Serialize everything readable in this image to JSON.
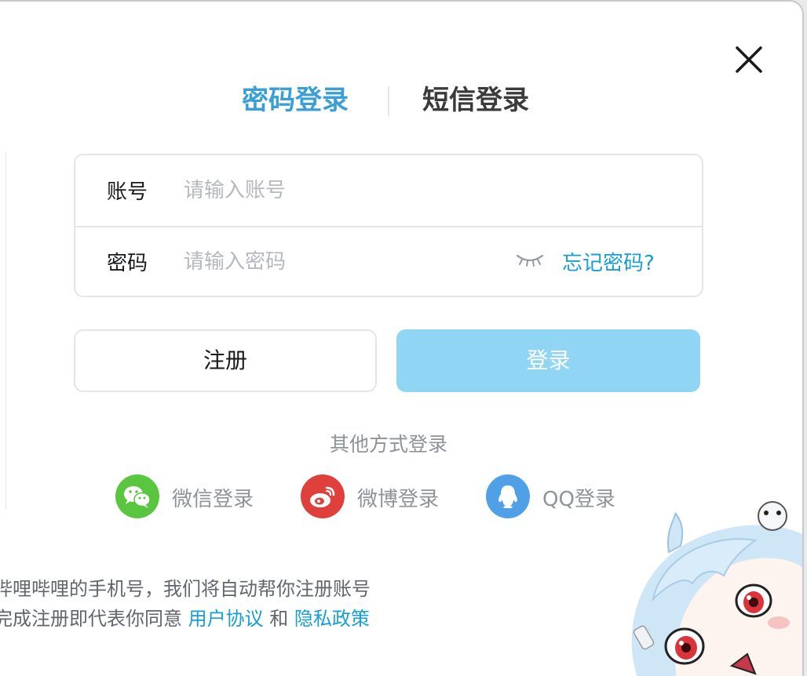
{
  "tabs": {
    "password_login": "密码登录",
    "sms_login": "短信登录"
  },
  "form": {
    "account_label": "账号",
    "account_placeholder": "请输入账号",
    "password_label": "密码",
    "password_placeholder": "请输入密码",
    "forgot_password": "忘记密码?"
  },
  "buttons": {
    "register": "注册",
    "login": "登录"
  },
  "other_login": {
    "title": "其他方式登录",
    "wechat": "微信登录",
    "weibo": "微博登录",
    "qq": "QQ登录"
  },
  "footer": {
    "line1": "哔哩哔哩的手机号，我们将自动帮你注册账号",
    "line2_prefix": "完成注册即代表你同意 ",
    "user_agreement": "用户协议",
    "and": " 和 ",
    "privacy_policy": "隐私政策"
  },
  "colors": {
    "accent": "#179ed6",
    "login_button": "#91d5f5",
    "wechat": "#5ac53e",
    "weibo": "#e0403b",
    "qq": "#4fa0e6"
  },
  "icons": {
    "close": "close-icon",
    "eye": "eye-closed-icon",
    "wechat": "wechat-icon",
    "weibo": "weibo-icon",
    "qq": "qq-icon"
  }
}
